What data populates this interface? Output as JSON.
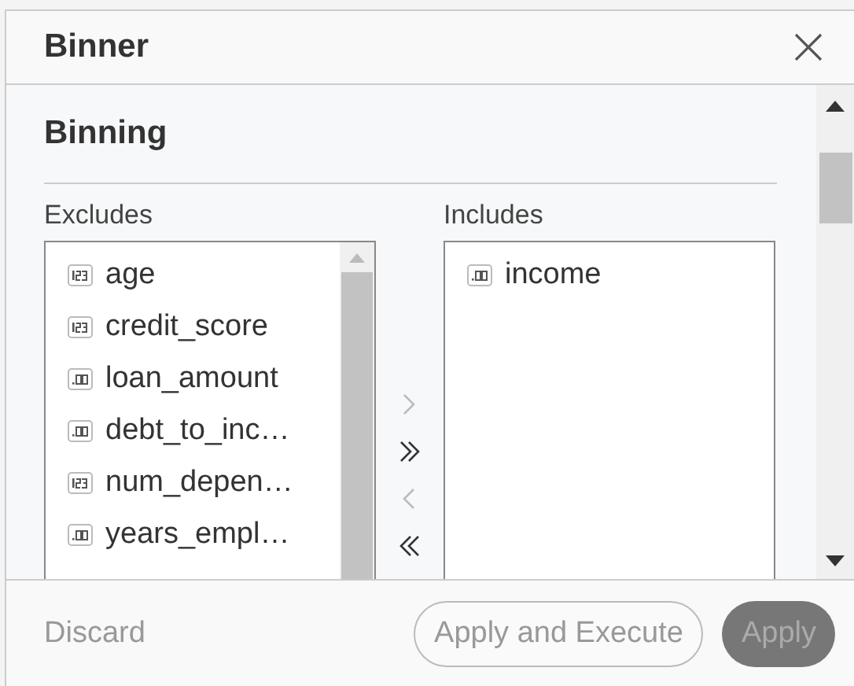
{
  "dialog": {
    "title": "Binner"
  },
  "section": {
    "title": "Binning"
  },
  "excludes": {
    "label": "Excludes",
    "items": [
      {
        "name": "age",
        "kind": "integer"
      },
      {
        "name": "credit_score",
        "kind": "integer"
      },
      {
        "name": "loan_amount",
        "kind": "decimal"
      },
      {
        "name": "debt_to_inc…",
        "kind": "decimal"
      },
      {
        "name": "num_depen…",
        "kind": "integer"
      },
      {
        "name": "years_empl…",
        "kind": "decimal"
      }
    ]
  },
  "transfer_buttons": [
    {
      "kind": "move-one-right",
      "disabled": true
    },
    {
      "kind": "move-all-right",
      "disabled": false
    },
    {
      "kind": "move-one-left",
      "disabled": true
    },
    {
      "kind": "move-all-left",
      "disabled": false
    }
  ],
  "includes": {
    "label": "Includes",
    "items": [
      {
        "name": "income",
        "kind": "decimal"
      }
    ]
  },
  "footer": {
    "buttons": [
      {
        "label": "Discard",
        "kind": "text",
        "disabled": true
      },
      {
        "label": "Apply and Execute",
        "kind": "outline",
        "disabled": true
      },
      {
        "label": "Apply",
        "kind": "filled",
        "disabled": true
      }
    ]
  }
}
